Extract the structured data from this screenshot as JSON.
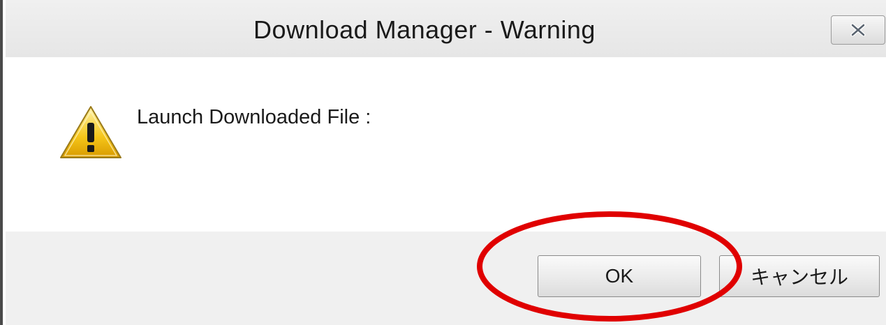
{
  "window": {
    "title": "Download Manager - Warning"
  },
  "icons": {
    "close": "close-icon",
    "warning": "warning-icon"
  },
  "dialog": {
    "message": "Launch Downloaded File :"
  },
  "buttons": {
    "ok_label": "OK",
    "cancel_label": "キャンセル"
  },
  "annotation": {
    "highlight_color": "#e00000"
  }
}
